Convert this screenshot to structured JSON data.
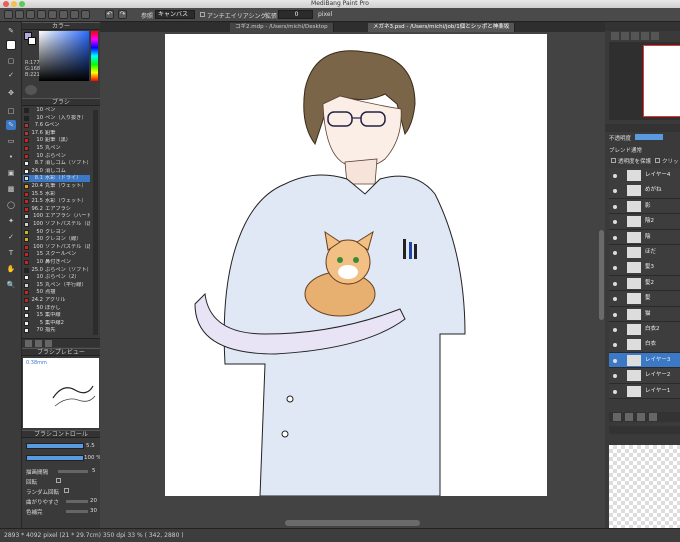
{
  "window": {
    "title": "MediBang Paint Pro"
  },
  "toolbar": {
    "ref_label": "参照",
    "ref_value": "キャンバス",
    "antialias_label": "アンチエイリアシング",
    "expand_label": "拡張",
    "expand_value": "0",
    "expand_unit": "pixel"
  },
  "tabs": [
    {
      "label": "コギ2.mdp - /Users/michi/Desktop",
      "active": false
    },
    {
      "label": "メガネ3.psd - /Users/michi/job/1個とシッポと神楽坂",
      "active": true
    }
  ],
  "color_panel": {
    "title": "カラー",
    "rgb": {
      "r": "R:177",
      "g": "G:168",
      "b": "B:221"
    }
  },
  "brush_panel": {
    "title": "ブラシ",
    "brushes": [
      {
        "size": "10",
        "name": "ペン",
        "color": "#222222"
      },
      {
        "size": "10",
        "name": "ペン（入り抜き）",
        "color": "#222222"
      },
      {
        "size": "7.6",
        "name": "Gペン",
        "color": "#c03030"
      },
      {
        "size": "17.6",
        "name": "鉛筆",
        "color": "#c03030"
      },
      {
        "size": "10",
        "name": "鉛筆（黒）",
        "color": "#d02020"
      },
      {
        "size": "15",
        "name": "丸ペン",
        "color": "#d02020"
      },
      {
        "size": "10",
        "name": "ぶらペン",
        "color": "#d02020"
      },
      {
        "size": "8.7",
        "name": "消しゴム（ソフト）",
        "color": "#f0f0f0"
      },
      {
        "size": "24.0",
        "name": "消しゴム",
        "color": "#f0f0f0"
      },
      {
        "size": "8.1",
        "name": "水彩（ドライ）",
        "color": "#e0e0e0"
      },
      {
        "size": "20.4",
        "name": "丸筆（ウェット）",
        "color": "#e0a020"
      },
      {
        "size": "15.5",
        "name": "水彩",
        "color": "#d02020"
      },
      {
        "size": "21.5",
        "name": "水彩（ウェット）",
        "color": "#d02020"
      },
      {
        "size": "96.2",
        "name": "エアブラシ",
        "color": "#d02020"
      },
      {
        "size": "100",
        "name": "エアブラシ（ハード）",
        "color": "#d0d0d0"
      },
      {
        "size": "100",
        "name": "ソフトパステル（ぼか",
        "color": "#d0d0d0"
      },
      {
        "size": "50",
        "name": "クレヨン",
        "color": "#d0b020"
      },
      {
        "size": "30",
        "name": "クレヨン（線）",
        "color": "#d0b020"
      },
      {
        "size": "100",
        "name": "ソフトパステル（ぼか",
        "color": "#d02020"
      },
      {
        "size": "15",
        "name": "スクールペン",
        "color": "#d02020"
      },
      {
        "size": "10",
        "name": "鼻付きペン",
        "color": "#d02020"
      },
      {
        "size": "25.0",
        "name": "ぶらペン（ソフト）",
        "color": "#222222"
      },
      {
        "size": "10",
        "name": "ぶらペン（2）",
        "color": "#f0f0f0"
      },
      {
        "size": "15",
        "name": "丸ペン（平行線）",
        "color": "#d0d0d0"
      },
      {
        "size": "50",
        "name": "点描",
        "color": "#d02020"
      },
      {
        "size": "24.2",
        "name": "アクリル",
        "color": "#d02020"
      },
      {
        "size": "50",
        "name": "ぼかし",
        "color": "#f0f0f0"
      },
      {
        "size": "15",
        "name": "集中線",
        "color": "#f0f0f0"
      },
      {
        "size": "5",
        "name": "集中線2",
        "color": "#f0f0f0"
      },
      {
        "size": "70",
        "name": "指先",
        "color": "#f0f0f0"
      }
    ]
  },
  "preview_panel": {
    "title": "ブラシプレビュー",
    "size": "0.38mm"
  },
  "control_panel": {
    "title": "ブラシコントロール",
    "size_value": "5.5",
    "opacity_value": "100 %",
    "spacing_label": "描画間隔",
    "spacing_value": "5",
    "rotate_label": "回転",
    "random_label": "ランダム回転",
    "smooth_label": "曲がりやすさ",
    "smooth_value": "20",
    "fill_label": "色補完",
    "fill_value": "30"
  },
  "status": {
    "text": "2893 * 4092 pixel  (21 * 29.7cm)  350 dpi  33 %  ( 342, 2880 )"
  },
  "layer_panel": {
    "opacity_label": "不透明度",
    "blend_label": "ブレンド",
    "blend_value": "通常",
    "protect_label": "透明度を保護",
    "clip_label": "クリッ",
    "layers": [
      {
        "name": "レイヤー4",
        "selected": false
      },
      {
        "name": "めがね",
        "selected": false
      },
      {
        "name": "影",
        "selected": false
      },
      {
        "name": "陰2",
        "selected": false
      },
      {
        "name": "陰",
        "selected": false
      },
      {
        "name": "ほだ",
        "selected": false
      },
      {
        "name": "髪3",
        "selected": false
      },
      {
        "name": "髪2",
        "selected": false
      },
      {
        "name": "髪",
        "selected": false
      },
      {
        "name": "猫",
        "selected": false
      },
      {
        "name": "白衣2",
        "selected": false
      },
      {
        "name": "白衣",
        "selected": false
      },
      {
        "name": "レイヤー3",
        "selected": true
      },
      {
        "name": "レイヤー2",
        "selected": false
      },
      {
        "name": "レイヤー1",
        "selected": false
      }
    ]
  }
}
